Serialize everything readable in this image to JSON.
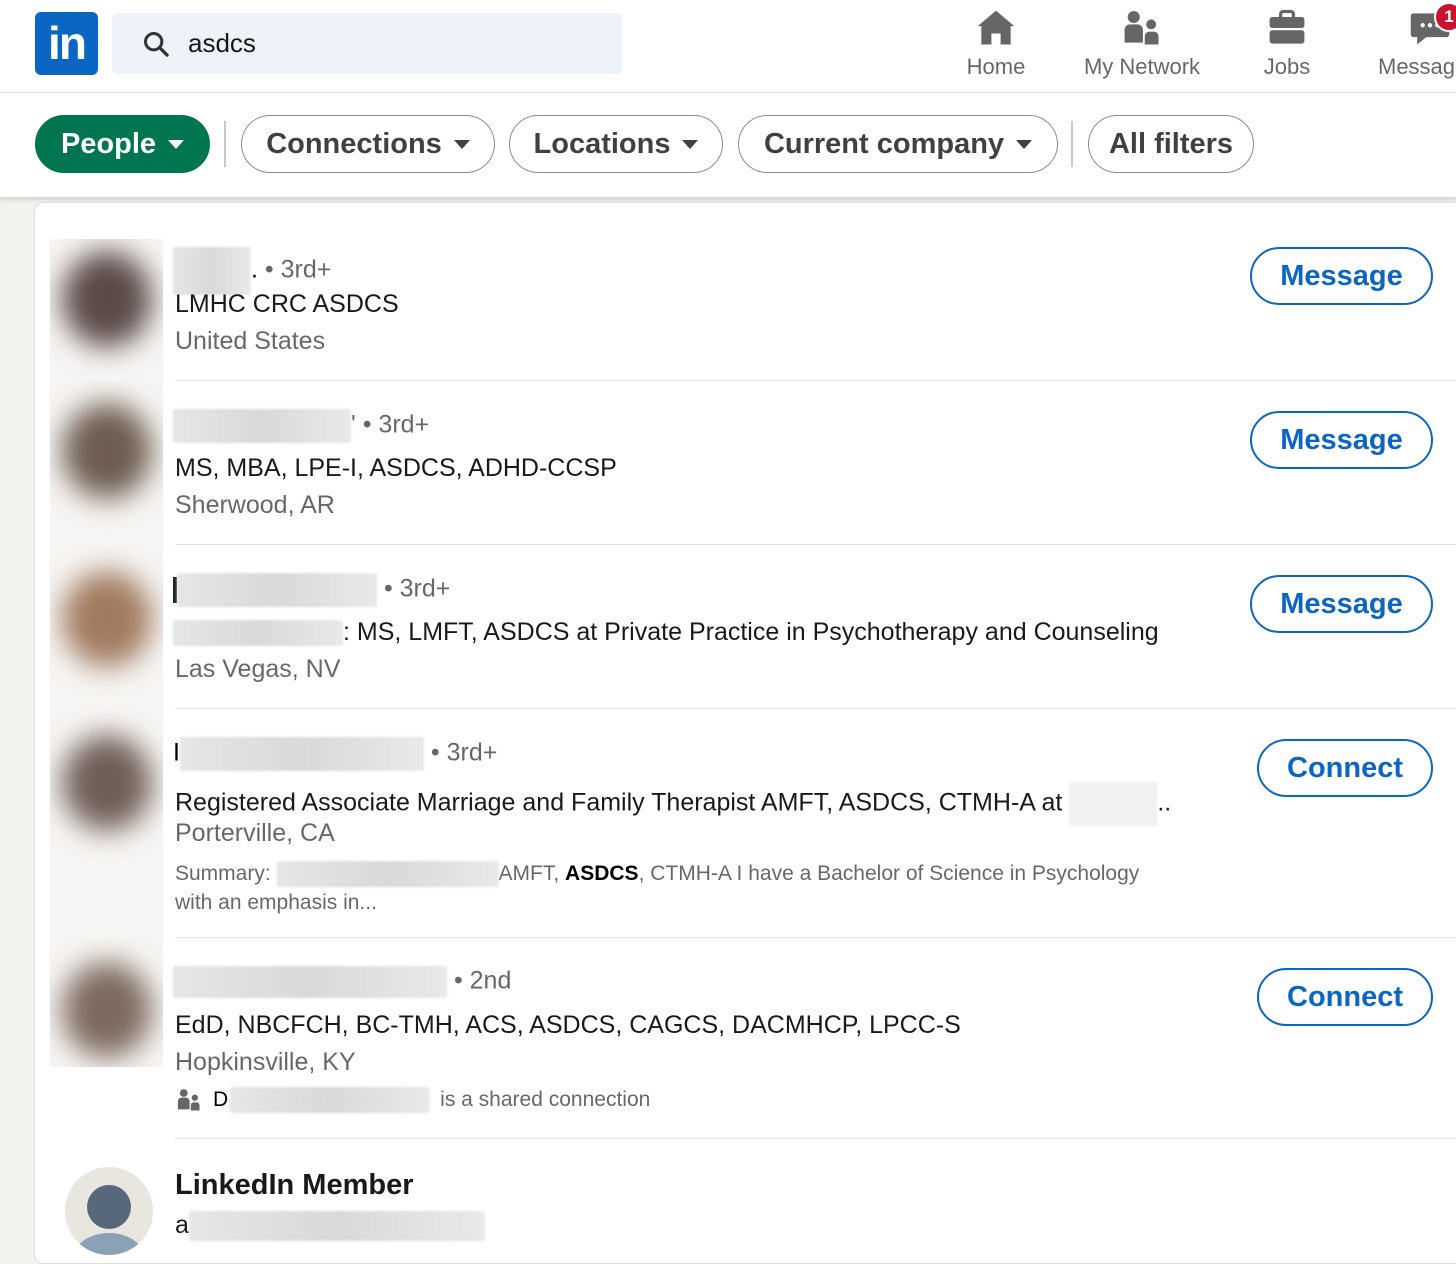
{
  "nav": {
    "logo": "in",
    "search_value": "asdcs",
    "items": [
      {
        "label": "Home",
        "icon": "home-icon"
      },
      {
        "label": "My Network",
        "icon": "network-icon"
      },
      {
        "label": "Jobs",
        "icon": "briefcase-icon"
      },
      {
        "label": "Messag",
        "icon": "messaging-icon",
        "badge": "1"
      }
    ]
  },
  "filters": {
    "people": "People",
    "connections": "Connections",
    "locations": "Locations",
    "current_company": "Current company",
    "all_filters": "All filters"
  },
  "results": [
    {
      "name_suffix": ".",
      "degree": "• 3rd+",
      "headline": "LMHC CRC ASDCS",
      "location": "United States",
      "action": "Message",
      "avatar_color": "#5a4a48"
    },
    {
      "name_suffix": "'",
      "degree": "• 3rd+",
      "headline": "MS, MBA, LPE-I, ASDCS, ADHD-CCSP",
      "location": "Sherwood, AR",
      "action": "Message",
      "avatar_color": "#6e5d50"
    },
    {
      "name_suffix": "",
      "degree": "• 3rd+",
      "headline_prefix": ":",
      "headline": "MS, LMFT, ASDCS at Private Practice in Psychotherapy and Counseling",
      "location": "Las Vegas, NV",
      "action": "Message",
      "avatar_color": "#a07a5e"
    },
    {
      "name_prefix": "I",
      "degree": "• 3rd+",
      "headline": "Registered Associate Marriage and Family Therapist AMFT, ASDCS, CTMH-A at",
      "headline_suffix": "..",
      "location": "Porterville, CA",
      "summary_label": "Summary:",
      "summary_mid": "AMFT,",
      "summary_bold": "ASDCS",
      "summary_rest": ", CTMH-A I have a Bachelor of Science in Psychology",
      "summary_line2": "with an emphasis in...",
      "action": "Connect",
      "avatar_color": "#6f5e58"
    },
    {
      "degree": "• 2nd",
      "headline": "EdD, NBCFCH, BC-TMH, ACS, ASDCS, CAGCS, DACMHCP, LPCC-S",
      "location": "Hopkinsville, KY",
      "shared_prefix": "D",
      "shared_text": "is a shared connection",
      "action": "Connect",
      "avatar_color": "#7d6a5f"
    }
  ],
  "member": {
    "name": "LinkedIn Member",
    "headline_prefix": "a"
  },
  "colors": {
    "brand": "#0a66c2",
    "active_filter": "#01754f",
    "badge": "#cb112d"
  }
}
